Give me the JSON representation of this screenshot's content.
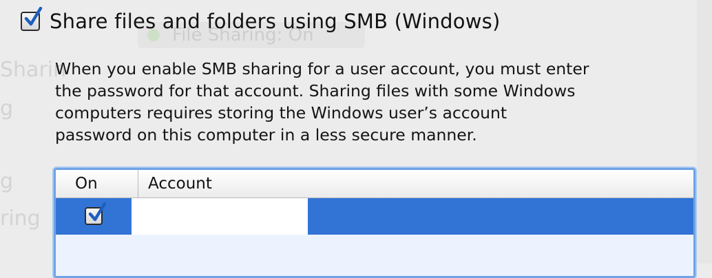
{
  "background_window": {
    "title": "File Sharing: On",
    "left_fragments": [
      "Sharin",
      "g",
      "g",
      "ring"
    ]
  },
  "smb": {
    "checkbox_checked": true,
    "label": "Share files and folders using SMB (Windows)",
    "description_lines": [
      "When you enable SMB sharing for a user account, you must enter",
      "the password for that account. Sharing files with some Windows",
      "computers requires storing the Windows user’s account",
      "password on this computer in a less secure manner."
    ]
  },
  "accounts_table": {
    "columns": [
      "On",
      "Account"
    ],
    "rows": [
      {
        "on": true,
        "account": ""
      }
    ],
    "selection_color": "#3274d6",
    "focus_ring_color": "#6fa3e4"
  }
}
